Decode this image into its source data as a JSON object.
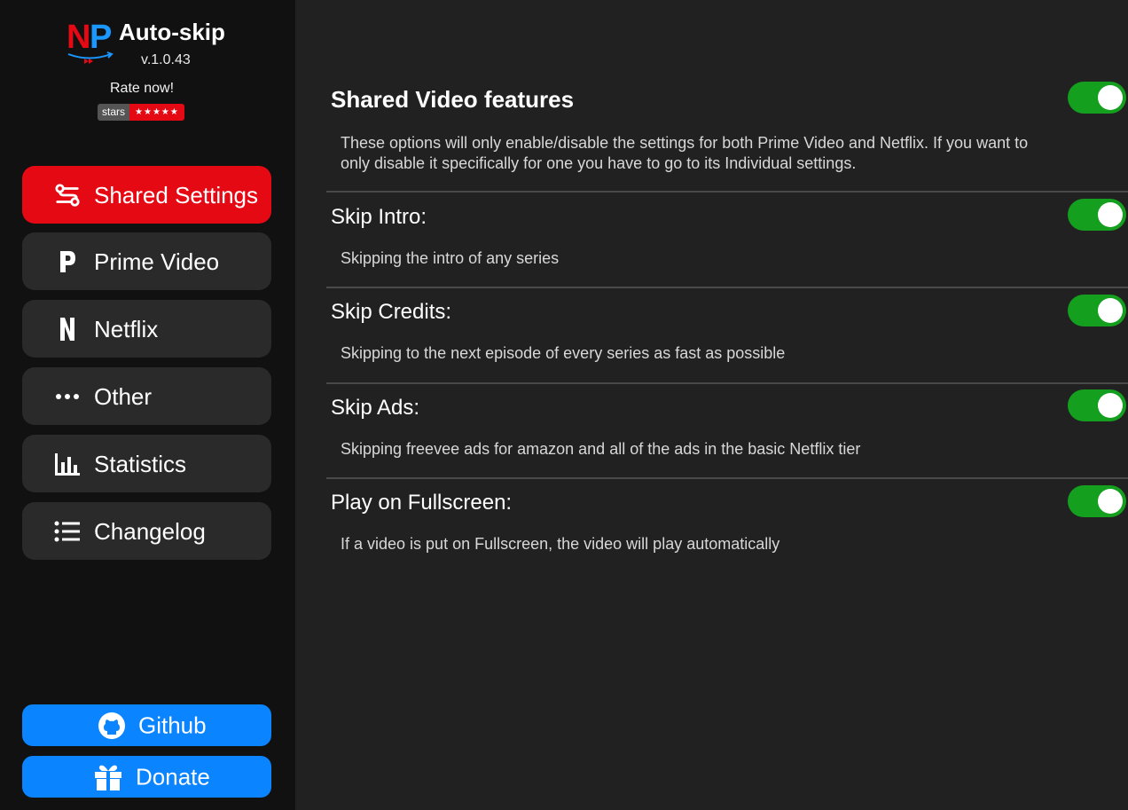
{
  "brand": {
    "logo_letter_1": "N",
    "logo_letter_2": "P",
    "title": "Auto-skip",
    "version": "v.1.0.43",
    "rate_label": "Rate now!",
    "stars_label": "stars",
    "stars_value": "★★★★★"
  },
  "nav": {
    "items": [
      {
        "label": "Shared Settings",
        "icon": "settings-sliders-icon",
        "active": true
      },
      {
        "label": "Prime Video",
        "icon": "prime-p-icon"
      },
      {
        "label": "Netflix",
        "icon": "netflix-n-icon"
      },
      {
        "label": "Other",
        "icon": "ellipsis-icon"
      },
      {
        "label": "Statistics",
        "icon": "bar-chart-icon"
      },
      {
        "label": "Changelog",
        "icon": "list-icon"
      }
    ]
  },
  "footer": {
    "github_label": "Github",
    "donate_label": "Donate"
  },
  "main": {
    "header": {
      "title": "Shared Video features",
      "description": "These options will only enable/disable the settings for both Prime Video and Netflix. If you want to only disable it specifically for one you have to go to its Individual settings.",
      "enabled": true
    },
    "settings": [
      {
        "title": "Skip Intro:",
        "description": "Skipping the intro of any series",
        "enabled": true
      },
      {
        "title": "Skip Credits:",
        "description": "Skipping to the next episode of every series as fast as possible",
        "enabled": true
      },
      {
        "title": "Skip Ads:",
        "description": "Skipping freevee ads for amazon and all of the ads in the basic Netflix tier",
        "enabled": true
      },
      {
        "title": "Play on Fullscreen:",
        "description": "If a video is put on Fullscreen, the video will play automatically",
        "enabled": true
      }
    ]
  },
  "colors": {
    "accent_red": "#e50914",
    "accent_blue": "#0a84ff",
    "toggle_on": "#14a01e",
    "sidebar_bg": "#111111",
    "main_bg": "#212121"
  }
}
